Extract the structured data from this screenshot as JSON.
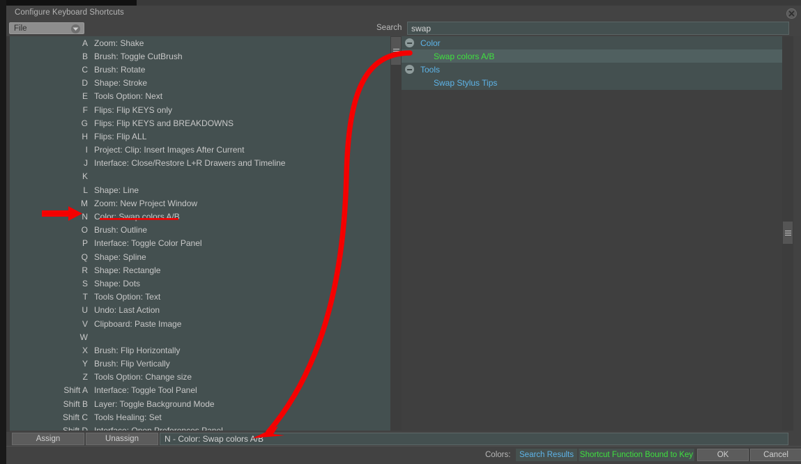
{
  "window": {
    "title": "Configure Keyboard Shortcuts",
    "close_icon": "close-circle-icon"
  },
  "toolbar": {
    "category_dropdown": {
      "value": "File",
      "icon": "chevron-down-circle-icon"
    },
    "search": {
      "label": "Search",
      "value": "swap",
      "placeholder": ""
    }
  },
  "shortcut_list": [
    {
      "key": "A",
      "action": "Zoom: Shake"
    },
    {
      "key": "B",
      "action": "Brush: Toggle CutBrush"
    },
    {
      "key": "C",
      "action": "Brush: Rotate"
    },
    {
      "key": "D",
      "action": "Shape: Stroke"
    },
    {
      "key": "E",
      "action": "Tools Option: Next"
    },
    {
      "key": "F",
      "action": "Flips: Flip KEYS only"
    },
    {
      "key": "G",
      "action": "Flips: Flip KEYS and BREAKDOWNS"
    },
    {
      "key": "H",
      "action": "Flips: Flip ALL"
    },
    {
      "key": "I",
      "action": "Project: Clip: Insert Images After Current"
    },
    {
      "key": "J",
      "action": "Interface: Close/Restore L+R Drawers and Timeline"
    },
    {
      "key": "K",
      "action": ""
    },
    {
      "key": "L",
      "action": "Shape: Line"
    },
    {
      "key": "M",
      "action": "Zoom: New Project Window"
    },
    {
      "key": "N",
      "action": "Color: Swap colors A/B"
    },
    {
      "key": "O",
      "action": "Brush: Outline"
    },
    {
      "key": "P",
      "action": "Interface: Toggle Color Panel"
    },
    {
      "key": "Q",
      "action": "Shape: Spline"
    },
    {
      "key": "R",
      "action": "Shape: Rectangle"
    },
    {
      "key": "S",
      "action": "Shape: Dots"
    },
    {
      "key": "T",
      "action": "Tools Option: Text"
    },
    {
      "key": "U",
      "action": "Undo: Last Action"
    },
    {
      "key": "V",
      "action": "Clipboard: Paste Image"
    },
    {
      "key": "W",
      "action": ""
    },
    {
      "key": "X",
      "action": "Brush: Flip Horizontally"
    },
    {
      "key": "Y",
      "action": "Brush: Flip Vertically"
    },
    {
      "key": "Z",
      "action": "Tools Option: Change size"
    },
    {
      "key": "Shift A",
      "action": "Interface: Toggle Tool Panel"
    },
    {
      "key": "Shift B",
      "action": "Layer: Toggle Background Mode"
    },
    {
      "key": "Shift C",
      "action": "Tools Healing: Set"
    },
    {
      "key": "Shift D",
      "action": "Interface: Open Preferences Panel"
    }
  ],
  "results_tree": [
    {
      "label": "Color",
      "type": "group",
      "expanded": true,
      "selected": false,
      "color": "blue"
    },
    {
      "label": "Swap colors A/B",
      "type": "item",
      "expanded": false,
      "selected": true,
      "color": "green"
    },
    {
      "label": "Tools",
      "type": "group",
      "expanded": true,
      "selected": false,
      "color": "blue"
    },
    {
      "label": "Swap Stylus Tips",
      "type": "item",
      "expanded": false,
      "selected": false,
      "color": "blue"
    }
  ],
  "actions": {
    "assign_label": "Assign",
    "unassign_label": "Unassign",
    "binding_value": "N - Color: Swap colors A/B"
  },
  "status": {
    "colors_label": "Colors:",
    "legend_search_results": "Search Results",
    "legend_bound_to_key": "Shortcut Function Bound to Key",
    "ok_label": "OK",
    "cancel_label": "Cancel"
  },
  "palette": {
    "panel_bg": "#445050",
    "selected_row": "#506060",
    "link_blue": "#5eb4e8",
    "bound_green": "#3fe03f",
    "annotation_red": "#f50000"
  }
}
